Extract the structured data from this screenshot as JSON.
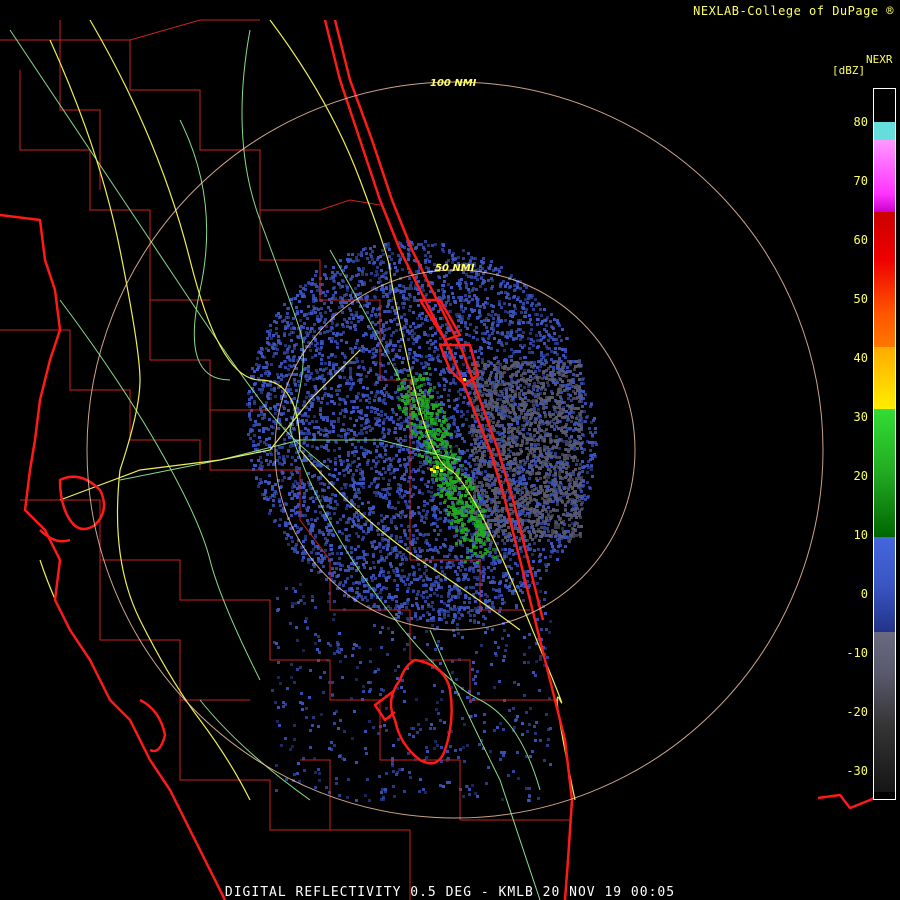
{
  "header": {
    "credit": "NEXLAB-College of DuPage ®"
  },
  "legend": {
    "product_id": "NEXR",
    "units": "[dBZ]",
    "ticks": [
      "80",
      "70",
      "60",
      "50",
      "40",
      "30",
      "20",
      "10",
      "0",
      "-10",
      "-20",
      "-30"
    ],
    "colors": {
      "gray": "#5a5a6e",
      "blue": "#3a56c4",
      "green": "#22aa22",
      "yellow": "#ffee00",
      "orange": "#ff7700",
      "red": "#ee0000",
      "magenta": "#ff33ff",
      "cyan": "#66dddd"
    }
  },
  "rings": {
    "inner_label": "50 NMI",
    "outer_label": "100 NMI"
  },
  "footer": {
    "caption": "DIGITAL REFLECTIVITY 0.5 DEG - KMLB 20 NOV 19 00:05"
  },
  "map_colors": {
    "coastline": "#ff1a1a",
    "county_lines": "#cc2222",
    "highways": "#eeee55",
    "roads": "#88dd88",
    "range_rings": "#ffccaa"
  }
}
